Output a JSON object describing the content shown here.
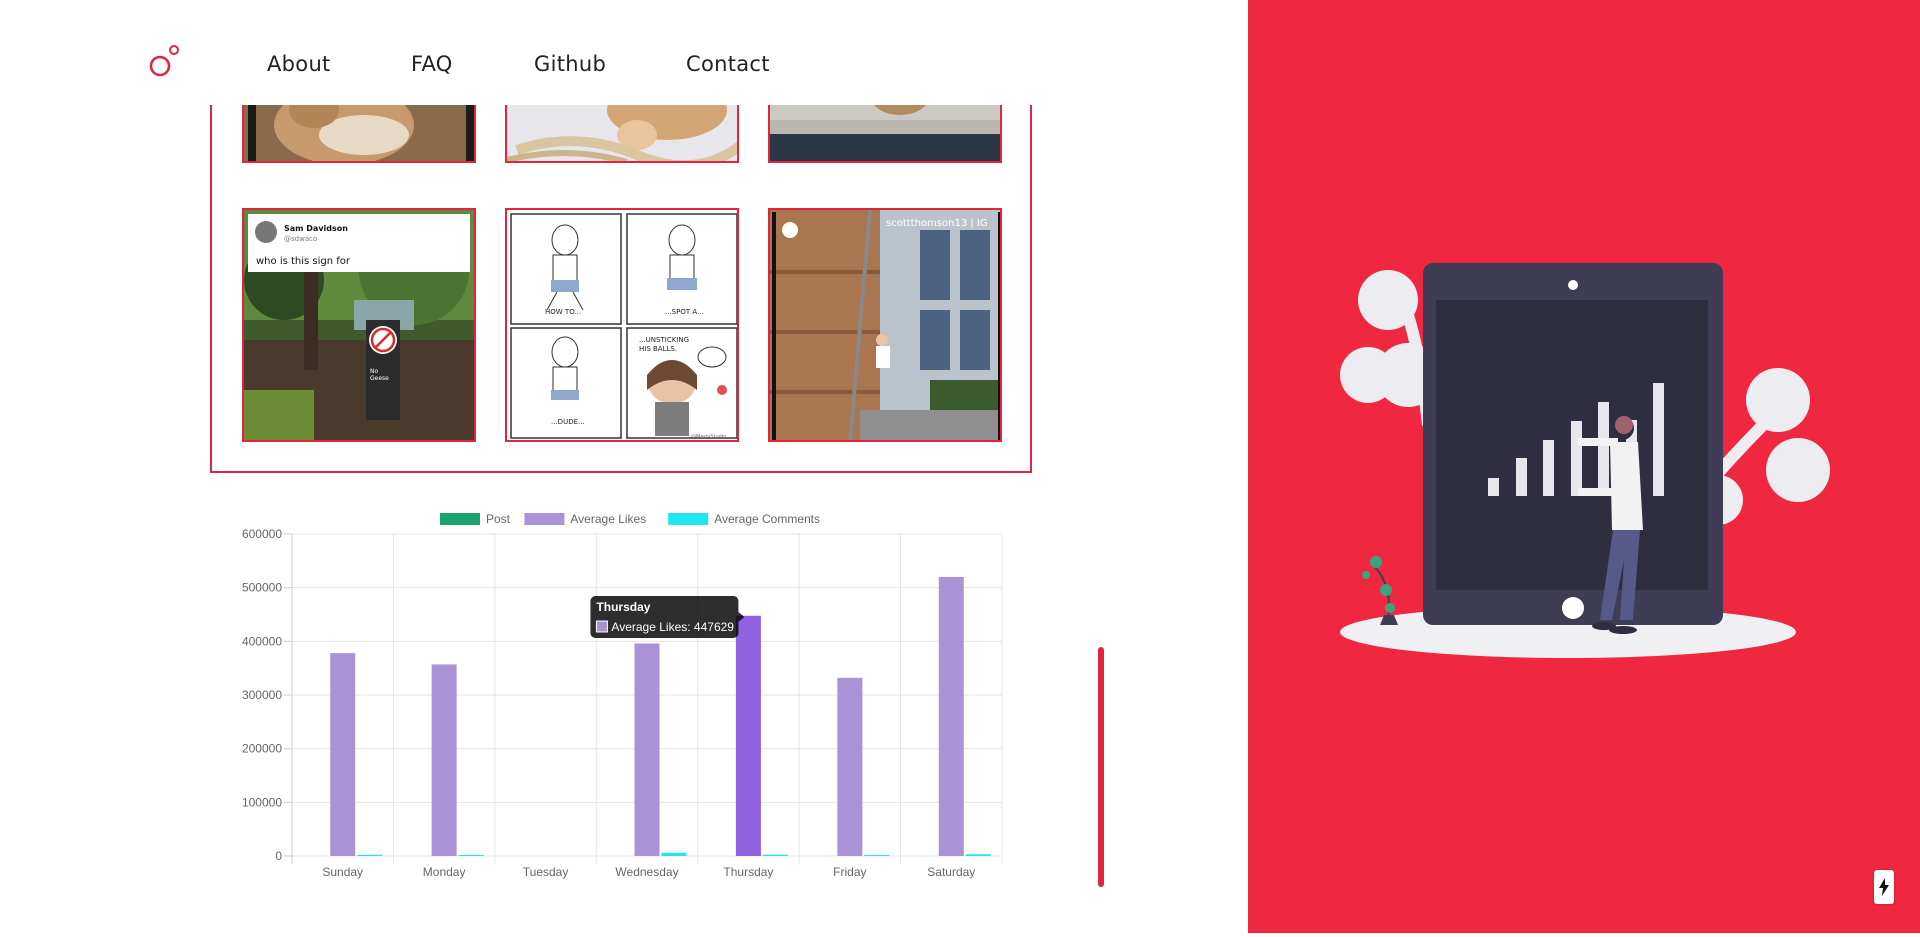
{
  "nav": {
    "links": [
      "About",
      "FAQ",
      "Github",
      "Contact"
    ]
  },
  "gallery": {
    "tweet_author": "Sam Davidson",
    "tweet_handle": "@sdwaco",
    "tweet_text": "who is this sign for",
    "sign_text": "No Geese",
    "comic_panels": [
      "HOW TO...",
      "...SPOT A...",
      "...DUDE...",
      "...UNSTICKING HIS BALLS."
    ],
    "comic_footer": "@MerryStudio",
    "video_caption": "scottthomson13 | IG"
  },
  "chart_data": {
    "type": "bar",
    "categories": [
      "Sunday",
      "Monday",
      "Tuesday",
      "Wednesday",
      "Thursday",
      "Friday",
      "Saturday"
    ],
    "series": [
      {
        "name": "Post",
        "color": "#1aa36a",
        "values": [
          2,
          2,
          0,
          3,
          2,
          2,
          3
        ]
      },
      {
        "name": "Average Likes",
        "color": "#a993d6",
        "values": [
          378000,
          357000,
          0,
          396000,
          447629,
          332000,
          520000
        ]
      },
      {
        "name": "Average Comments",
        "color": "#1ee6f2",
        "values": [
          2200,
          2000,
          0,
          6000,
          2500,
          1800,
          3300
        ]
      }
    ],
    "yticks": [
      "600000",
      "500000",
      "400000",
      "300000",
      "200000",
      "100000",
      "0"
    ],
    "ylim": [
      0,
      600000
    ],
    "legend_position": "top",
    "grid": true,
    "highlight_index": 4,
    "highlight_color": "#9163e0",
    "tooltip": {
      "title": "Thursday",
      "label": "Average Likes: 447629"
    }
  }
}
